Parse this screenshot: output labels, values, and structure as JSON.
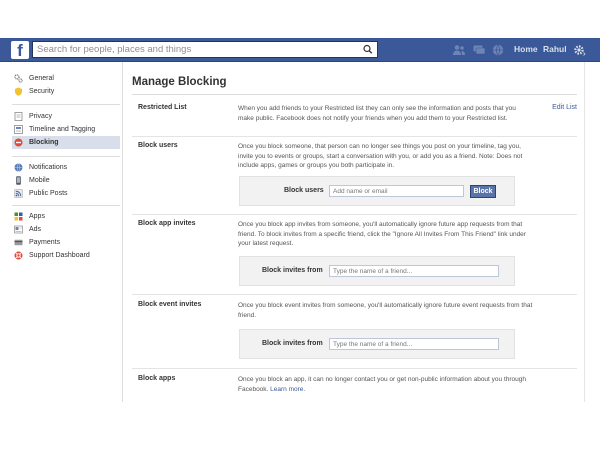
{
  "topbar": {
    "logo": "f",
    "search_placeholder": "Search for people, places and things",
    "links": [
      "Home",
      "Rahul"
    ],
    "icons": [
      "friend-requests-icon",
      "messages-icon",
      "notifications-icon",
      "settings-gear-icon"
    ]
  },
  "sidebar": {
    "groups": [
      [
        {
          "label": "General",
          "icon": "gear-icon"
        },
        {
          "label": "Security",
          "icon": "shield-icon"
        }
      ],
      [
        {
          "label": "Privacy",
          "icon": "privacy-icon"
        },
        {
          "label": "Timeline and Tagging",
          "icon": "timeline-icon"
        },
        {
          "label": "Blocking",
          "icon": "block-icon",
          "active": true
        }
      ],
      [
        {
          "label": "Notifications",
          "icon": "globe-icon"
        },
        {
          "label": "Mobile",
          "icon": "mobile-icon"
        },
        {
          "label": "Public Posts",
          "icon": "rss-icon"
        }
      ],
      [
        {
          "label": "Apps",
          "icon": "apps-icon"
        },
        {
          "label": "Ads",
          "icon": "ads-icon"
        },
        {
          "label": "Payments",
          "icon": "payments-icon"
        },
        {
          "label": "Support Dashboard",
          "icon": "support-icon"
        }
      ]
    ]
  },
  "main": {
    "title": "Manage Blocking",
    "restricted": {
      "label": "Restricted List",
      "desc": "When you add friends to your Restricted list they can only see the information and posts that you make public. Facebook does not notify your friends when you add them to your Restricted list.",
      "edit": "Edit List"
    },
    "block_users": {
      "label": "Block users",
      "desc": "Once you block someone, that person can no longer see things you post on your timeline, tag you, invite you to events or groups, start a conversation with you, or add you as a friend. Note: Does not include apps, games or groups you both participate in.",
      "form_label": "Block users",
      "placeholder": "Add name or email",
      "button": "Block"
    },
    "block_app_invites": {
      "label": "Block app invites",
      "desc": "Once you block app invites from someone, you'll automatically ignore future app requests from that friend. To block invites from a specific friend, click the \"Ignore All Invites From This Friend\" link under your latest request.",
      "form_label": "Block invites from",
      "placeholder": "Type the name of a friend..."
    },
    "block_event_invites": {
      "label": "Block event invites",
      "desc": "Once you block event invites from someone, you'll automatically ignore future event requests from that friend.",
      "form_label": "Block invites from",
      "placeholder": "Type the name of a friend..."
    },
    "block_apps": {
      "label": "Block apps",
      "desc": "Once you block an app, it can no longer contact you or get non-public information about you through Facebook.",
      "learn_more": "Learn more."
    }
  }
}
